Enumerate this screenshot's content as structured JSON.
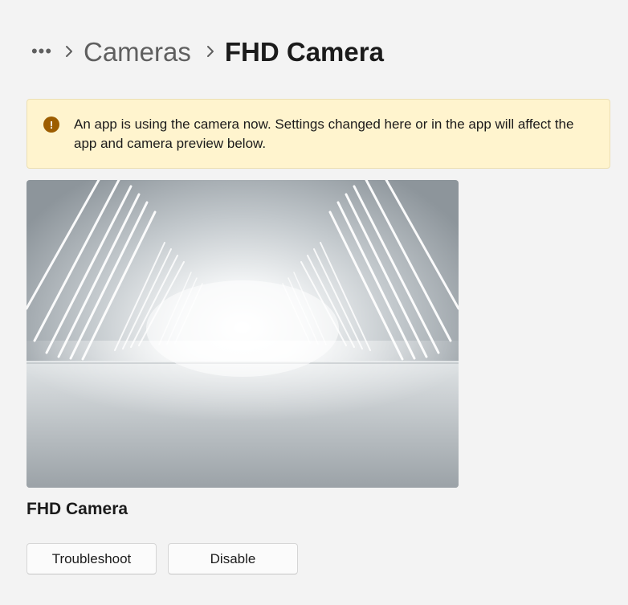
{
  "breadcrumb": {
    "more_glyph": "•••",
    "parent": "Cameras",
    "current": "FHD Camera"
  },
  "infobar": {
    "icon": "warning-exclamation-icon",
    "message": "An app is using the camera now. Settings changed here or in the app will affect the app and camera preview below."
  },
  "preview": {
    "description_icon": "camera-preview-image"
  },
  "camera": {
    "name": "FHD Camera"
  },
  "actions": {
    "troubleshoot_label": "Troubleshoot",
    "disable_label": "Disable"
  },
  "colors": {
    "background": "#f3f3f3",
    "infobar_bg": "#fff4ce",
    "warning_icon": "#9d5d00"
  }
}
